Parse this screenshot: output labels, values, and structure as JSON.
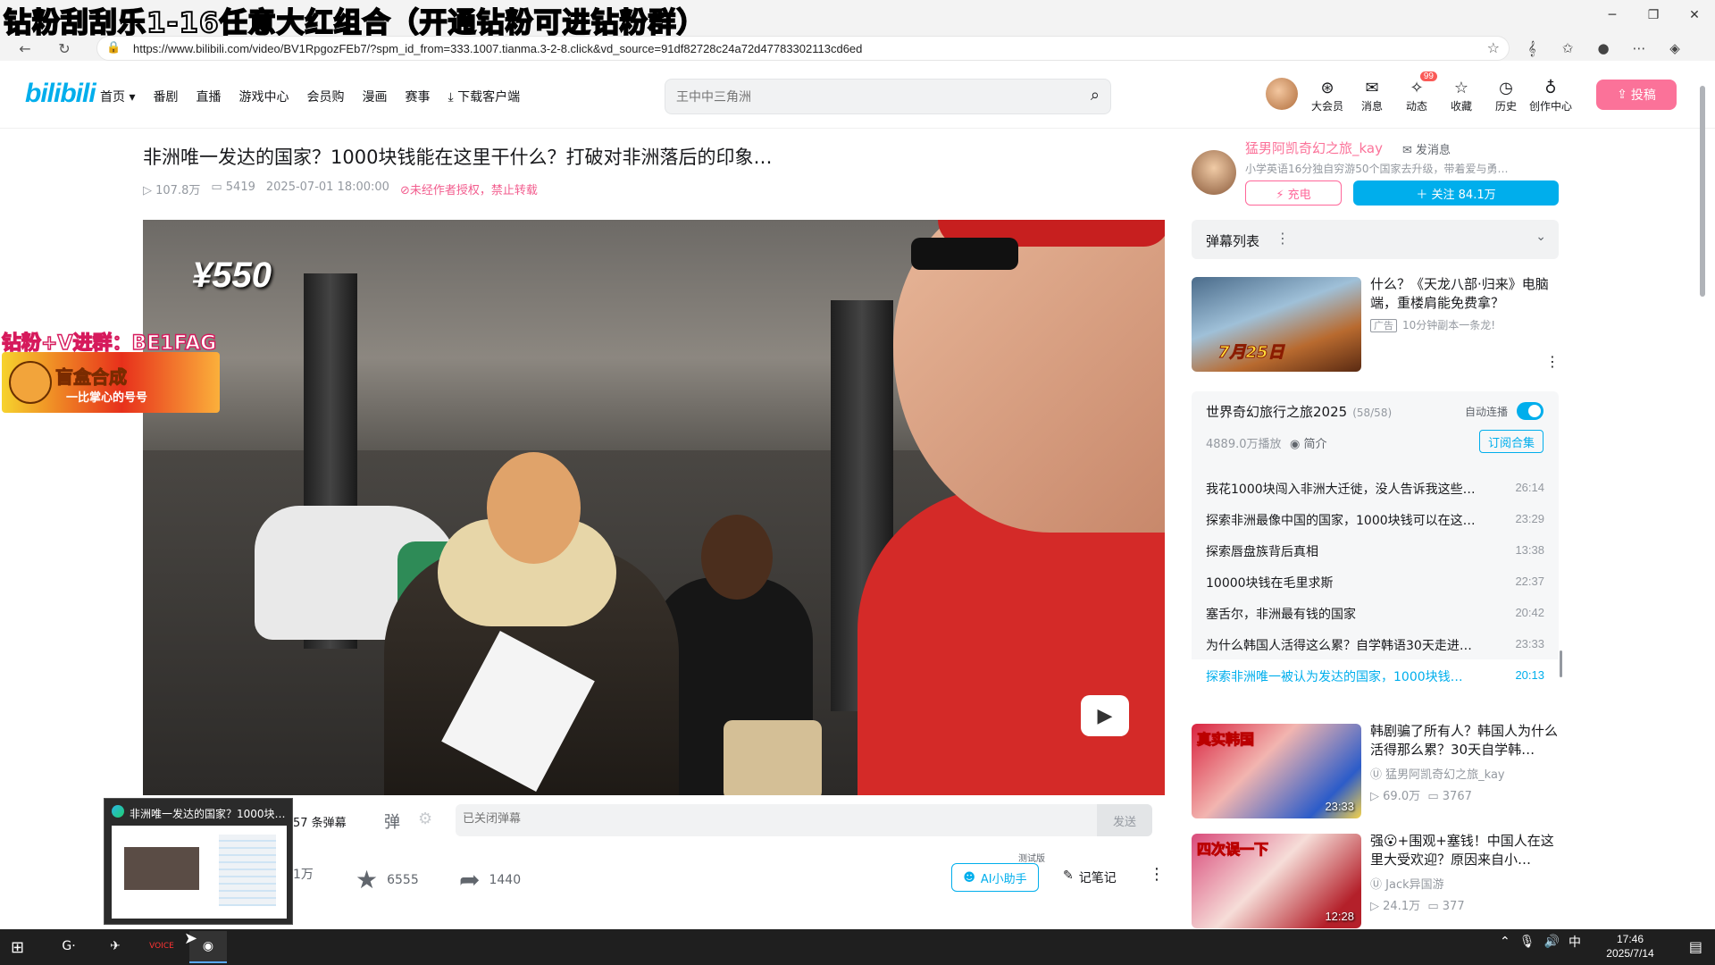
{
  "overlay_title": "钻粉刮刮乐1-16任意大红组合（开通钻粉可进钻粉群）",
  "browser": {
    "url": "https://www.bilibili.com/video/BV1RpgozFEb7/?spm_id_from=333.1007.tianma.3-2-8.click&vd_source=91df82728c24a72d47783302113cd6ed"
  },
  "header": {
    "logo": "bilibili",
    "nav": [
      "首页 ▾",
      "番剧",
      "直播",
      "游戏中心",
      "会员购",
      "漫画",
      "赛事",
      "⤓ 下载客户端"
    ],
    "search_placeholder": "王中中三角洲",
    "icons": [
      {
        "label": "大会员",
        "icon": "vip-icon",
        "glyph": "⊛",
        "badge": ""
      },
      {
        "label": "消息",
        "icon": "message-icon",
        "glyph": "✉",
        "badge": ""
      },
      {
        "label": "动态",
        "icon": "dynamic-icon",
        "glyph": "✧",
        "badge": "99"
      },
      {
        "label": "收藏",
        "icon": "favorite-icon",
        "glyph": "☆",
        "badge": ""
      },
      {
        "label": "历史",
        "icon": "history-icon",
        "glyph": "◷",
        "badge": ""
      },
      {
        "label": "创作中心",
        "icon": "creator-icon",
        "glyph": "♁",
        "badge": ""
      }
    ],
    "upload_label": "投稿"
  },
  "video": {
    "title": "非洲唯一发达的国家？1000块钱能在这里干什么？打破对非洲落后的印象…",
    "views": "107.8万",
    "danmaku": "5419",
    "date": "2025-07-01 18:00:00",
    "copyright": "未经作者授权，禁止转载",
    "price_overlay": "¥550"
  },
  "left_ad": {
    "invite": "钻粉+V进群：BE1FAG",
    "banner_title": "盲盒合成",
    "banner_sub": "一比掌心的号号"
  },
  "danmaku_bar": {
    "count": "57 条弹幕",
    "input_placeholder": "已关闭弹幕",
    "send": "发送"
  },
  "actions": {
    "like": "1万",
    "favorite": "6555",
    "share": "1440",
    "ai": "AI小助手",
    "ai_tag": "测试版",
    "note": "记笔记"
  },
  "uploader": {
    "name": "猛男阿凯奇幻之旅_kay",
    "message": "发消息",
    "desc": "小学英语16分独自穷游50个国家去升级，带着爱与勇…",
    "charge": "⚡ 充电",
    "follow": "＋ 关注 84.1万"
  },
  "danmaku_list": {
    "title": "弹幕列表"
  },
  "ad": {
    "title": "什么？《天龙八部·归来》电脑端，重楼肩能免费拿？",
    "tag": "广告",
    "sub": "10分钟副本一条龙!",
    "thumb_text": "7月25日"
  },
  "collection": {
    "title": "世界奇幻旅行之旅2025",
    "count": "(58/58)",
    "autoplay": "自动连播",
    "views": "4889.0万播放",
    "intro": "简介",
    "subscribe": "订阅合集",
    "episodes": [
      {
        "name": "我花1000块闯入非洲大迁徙，没人告诉我这些…",
        "dur": "26:14"
      },
      {
        "name": "探索非洲最像中国的国家，1000块钱可以在这…",
        "dur": "23:29"
      },
      {
        "name": "探索唇盘族背后真相",
        "dur": "13:38"
      },
      {
        "name": "10000块钱在毛里求斯",
        "dur": "22:37"
      },
      {
        "name": "塞舌尔，非洲最有钱的国家",
        "dur": "20:42"
      },
      {
        "name": "为什么韩国人活得这么累？自学韩语30天走进…",
        "dur": "23:33"
      },
      {
        "name": "探索非洲唯一被认为发达的国家，1000块钱…",
        "dur": "20:13"
      }
    ]
  },
  "recommendations": [
    {
      "title": "韩剧骗了所有人？韩国人为什么活得那么累？30天自学韩…",
      "up": "猛男阿凯奇幻之旅_kay",
      "views": "69.0万",
      "dm": "3767",
      "dur": "23:33",
      "thumb_text": "真实韩国"
    },
    {
      "title": "强😮+围观+塞钱！中国人在这里大受欢迎？原因来自小…",
      "up": "Jack异国游",
      "views": "24.1万",
      "dm": "377",
      "dur": "12:28",
      "thumb_text": "四次误一下"
    }
  ],
  "task_preview": {
    "title": "非洲唯一发达的国家？1000块…"
  },
  "taskbar": {
    "apps": [
      "G·",
      "✈",
      "VOICE",
      "◉"
    ],
    "time": "17:46",
    "date": "2025/7/14",
    "ime": "中"
  }
}
